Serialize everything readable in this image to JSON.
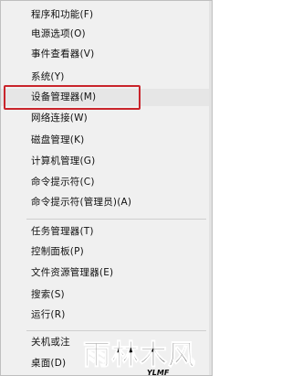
{
  "menu": {
    "items": [
      {
        "label": "程序和功能(F)"
      },
      {
        "label": "电源选项(O)"
      },
      {
        "label": "事件查看器(V)"
      },
      {
        "label": "系统(Y)"
      },
      {
        "label": "设备管理器(M)"
      },
      {
        "label": "网络连接(W)"
      },
      {
        "label": "磁盘管理(K)"
      },
      {
        "label": "计算机管理(G)"
      },
      {
        "label": "命令提示符(C)"
      },
      {
        "label": "命令提示符(管理员)(A)"
      },
      {
        "label": "任务管理器(T)"
      },
      {
        "label": "控制面板(P)"
      },
      {
        "label": "文件资源管理器(E)"
      },
      {
        "label": "搜索(S)"
      },
      {
        "label": "运行(R)"
      },
      {
        "label": "关机或注"
      },
      {
        "label": "桌面(D)"
      }
    ],
    "highlighted_item": "设备管理器(M)",
    "highlight_color": "#c9242b"
  },
  "watermark": {
    "text": "雨林木风",
    "subtext": "YLMF"
  }
}
